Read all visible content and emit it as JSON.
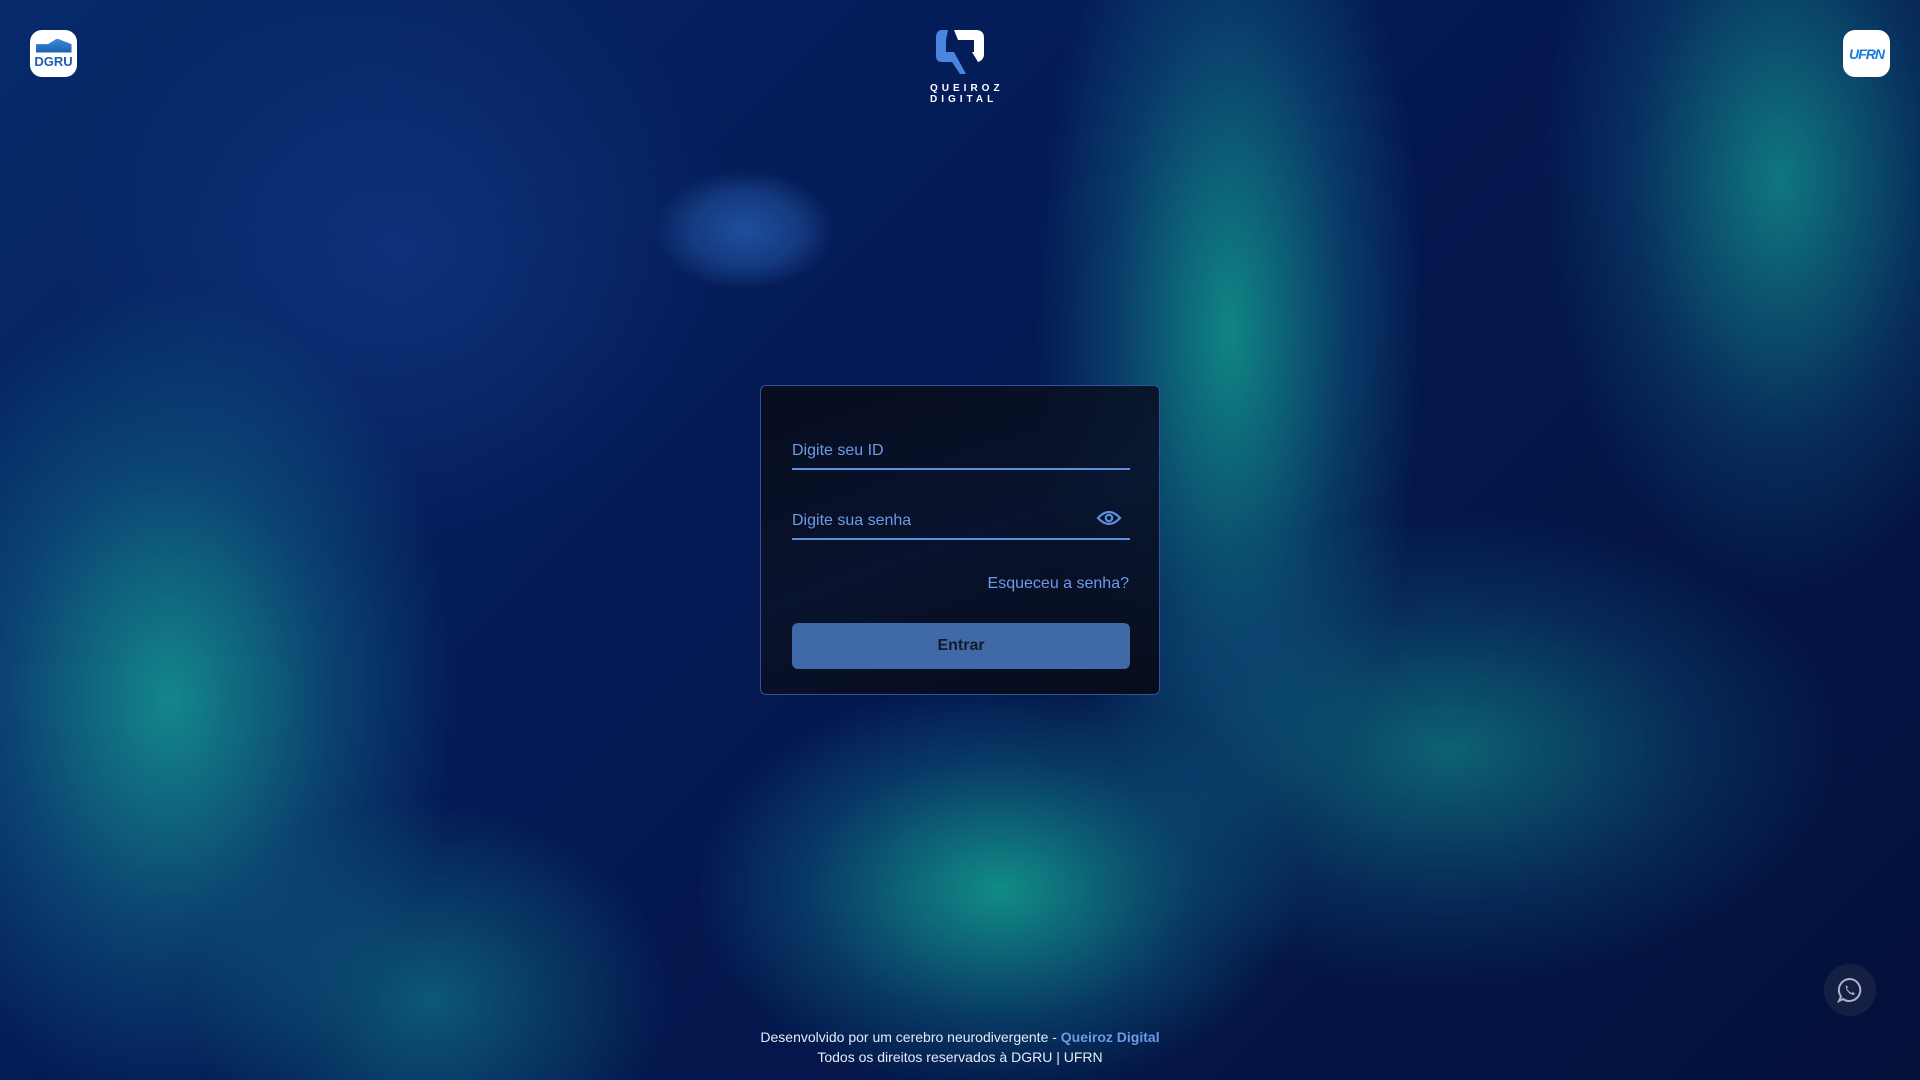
{
  "header": {
    "left_logo": "DGRU",
    "center_logo": {
      "line1": "QUEIROZ",
      "line2": "DIGITAL"
    },
    "right_logo": "UFRN"
  },
  "login": {
    "id_placeholder": "Digite seu ID",
    "password_placeholder": "Digite sua senha",
    "show_password_icon": "eye-icon",
    "forgot_label": "Esqueceu a senha?",
    "submit_label": "Entrar"
  },
  "footer": {
    "line1_prefix": "Desenvolvido por um cerebro neurodivergente - ",
    "line1_link": "Queiroz Digital",
    "line2": "Todos os direitos reservados à DGRU | UFRN"
  },
  "whatsapp_icon": "whatsapp-icon",
  "colors": {
    "accent": "#5b8fe0",
    "button": "#4069a8",
    "background": "#03103a"
  }
}
